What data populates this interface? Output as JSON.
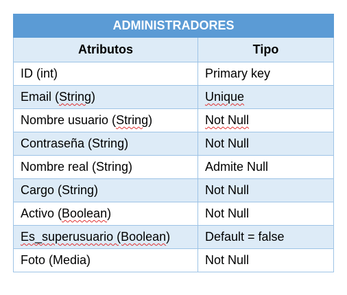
{
  "table": {
    "title": "ADMINISTRADORES",
    "headers": [
      "Atributos",
      "Tipo"
    ],
    "rows": [
      {
        "pre": "ID (int)",
        "sq": "",
        "post": "",
        "tipo": "Primary key",
        "tipo_sq": ""
      },
      {
        "pre": "Email (",
        "sq": "String",
        "post": ")",
        "tipo": "",
        "tipo_sq": "Unique"
      },
      {
        "pre": "Nombre usuario (",
        "sq": "String",
        "post": ")",
        "tipo": "",
        "tipo_sq": "Not Null"
      },
      {
        "pre": "Contraseña (String)",
        "sq": "",
        "post": "",
        "tipo": "Not Null",
        "tipo_sq": ""
      },
      {
        "pre": "Nombre real (String)",
        "sq": "",
        "post": "",
        "tipo": "Admite Null",
        "tipo_sq": ""
      },
      {
        "pre": "Cargo (String)",
        "sq": "",
        "post": "",
        "tipo": "Not Null",
        "tipo_sq": ""
      },
      {
        "pre": "Activo (",
        "sq": "Boolean",
        "post": ")",
        "tipo": "Not Null",
        "tipo_sq": ""
      },
      {
        "pre": "",
        "sq": "Es_superusuario (Boolean",
        "post": ")",
        "tipo": "Default = false",
        "tipo_sq": ""
      },
      {
        "pre": "Foto (Media)",
        "sq": "",
        "post": "",
        "tipo": "Not Null",
        "tipo_sq": ""
      }
    ]
  }
}
